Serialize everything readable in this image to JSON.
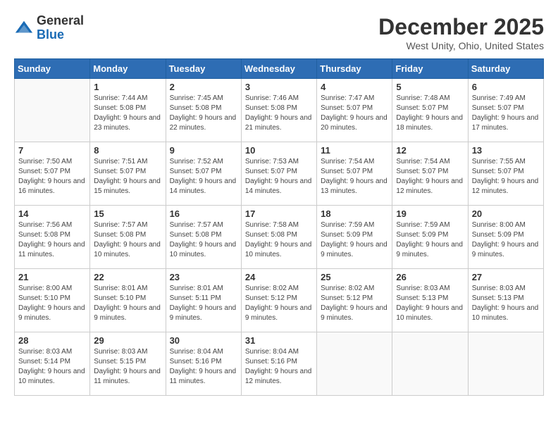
{
  "logo": {
    "general": "General",
    "blue": "Blue"
  },
  "title": "December 2025",
  "location": "West Unity, Ohio, United States",
  "days_header": [
    "Sunday",
    "Monday",
    "Tuesday",
    "Wednesday",
    "Thursday",
    "Friday",
    "Saturday"
  ],
  "weeks": [
    [
      {
        "day": "",
        "sunrise": "",
        "sunset": "",
        "daylight": ""
      },
      {
        "day": "1",
        "sunrise": "Sunrise: 7:44 AM",
        "sunset": "Sunset: 5:08 PM",
        "daylight": "Daylight: 9 hours and 23 minutes."
      },
      {
        "day": "2",
        "sunrise": "Sunrise: 7:45 AM",
        "sunset": "Sunset: 5:08 PM",
        "daylight": "Daylight: 9 hours and 22 minutes."
      },
      {
        "day": "3",
        "sunrise": "Sunrise: 7:46 AM",
        "sunset": "Sunset: 5:08 PM",
        "daylight": "Daylight: 9 hours and 21 minutes."
      },
      {
        "day": "4",
        "sunrise": "Sunrise: 7:47 AM",
        "sunset": "Sunset: 5:07 PM",
        "daylight": "Daylight: 9 hours and 20 minutes."
      },
      {
        "day": "5",
        "sunrise": "Sunrise: 7:48 AM",
        "sunset": "Sunset: 5:07 PM",
        "daylight": "Daylight: 9 hours and 18 minutes."
      },
      {
        "day": "6",
        "sunrise": "Sunrise: 7:49 AM",
        "sunset": "Sunset: 5:07 PM",
        "daylight": "Daylight: 9 hours and 17 minutes."
      }
    ],
    [
      {
        "day": "7",
        "sunrise": "Sunrise: 7:50 AM",
        "sunset": "Sunset: 5:07 PM",
        "daylight": "Daylight: 9 hours and 16 minutes."
      },
      {
        "day": "8",
        "sunrise": "Sunrise: 7:51 AM",
        "sunset": "Sunset: 5:07 PM",
        "daylight": "Daylight: 9 hours and 15 minutes."
      },
      {
        "day": "9",
        "sunrise": "Sunrise: 7:52 AM",
        "sunset": "Sunset: 5:07 PM",
        "daylight": "Daylight: 9 hours and 14 minutes."
      },
      {
        "day": "10",
        "sunrise": "Sunrise: 7:53 AM",
        "sunset": "Sunset: 5:07 PM",
        "daylight": "Daylight: 9 hours and 14 minutes."
      },
      {
        "day": "11",
        "sunrise": "Sunrise: 7:54 AM",
        "sunset": "Sunset: 5:07 PM",
        "daylight": "Daylight: 9 hours and 13 minutes."
      },
      {
        "day": "12",
        "sunrise": "Sunrise: 7:54 AM",
        "sunset": "Sunset: 5:07 PM",
        "daylight": "Daylight: 9 hours and 12 minutes."
      },
      {
        "day": "13",
        "sunrise": "Sunrise: 7:55 AM",
        "sunset": "Sunset: 5:07 PM",
        "daylight": "Daylight: 9 hours and 12 minutes."
      }
    ],
    [
      {
        "day": "14",
        "sunrise": "Sunrise: 7:56 AM",
        "sunset": "Sunset: 5:08 PM",
        "daylight": "Daylight: 9 hours and 11 minutes."
      },
      {
        "day": "15",
        "sunrise": "Sunrise: 7:57 AM",
        "sunset": "Sunset: 5:08 PM",
        "daylight": "Daylight: 9 hours and 10 minutes."
      },
      {
        "day": "16",
        "sunrise": "Sunrise: 7:57 AM",
        "sunset": "Sunset: 5:08 PM",
        "daylight": "Daylight: 9 hours and 10 minutes."
      },
      {
        "day": "17",
        "sunrise": "Sunrise: 7:58 AM",
        "sunset": "Sunset: 5:08 PM",
        "daylight": "Daylight: 9 hours and 10 minutes."
      },
      {
        "day": "18",
        "sunrise": "Sunrise: 7:59 AM",
        "sunset": "Sunset: 5:09 PM",
        "daylight": "Daylight: 9 hours and 9 minutes."
      },
      {
        "day": "19",
        "sunrise": "Sunrise: 7:59 AM",
        "sunset": "Sunset: 5:09 PM",
        "daylight": "Daylight: 9 hours and 9 minutes."
      },
      {
        "day": "20",
        "sunrise": "Sunrise: 8:00 AM",
        "sunset": "Sunset: 5:09 PM",
        "daylight": "Daylight: 9 hours and 9 minutes."
      }
    ],
    [
      {
        "day": "21",
        "sunrise": "Sunrise: 8:00 AM",
        "sunset": "Sunset: 5:10 PM",
        "daylight": "Daylight: 9 hours and 9 minutes."
      },
      {
        "day": "22",
        "sunrise": "Sunrise: 8:01 AM",
        "sunset": "Sunset: 5:10 PM",
        "daylight": "Daylight: 9 hours and 9 minutes."
      },
      {
        "day": "23",
        "sunrise": "Sunrise: 8:01 AM",
        "sunset": "Sunset: 5:11 PM",
        "daylight": "Daylight: 9 hours and 9 minutes."
      },
      {
        "day": "24",
        "sunrise": "Sunrise: 8:02 AM",
        "sunset": "Sunset: 5:12 PM",
        "daylight": "Daylight: 9 hours and 9 minutes."
      },
      {
        "day": "25",
        "sunrise": "Sunrise: 8:02 AM",
        "sunset": "Sunset: 5:12 PM",
        "daylight": "Daylight: 9 hours and 9 minutes."
      },
      {
        "day": "26",
        "sunrise": "Sunrise: 8:03 AM",
        "sunset": "Sunset: 5:13 PM",
        "daylight": "Daylight: 9 hours and 10 minutes."
      },
      {
        "day": "27",
        "sunrise": "Sunrise: 8:03 AM",
        "sunset": "Sunset: 5:13 PM",
        "daylight": "Daylight: 9 hours and 10 minutes."
      }
    ],
    [
      {
        "day": "28",
        "sunrise": "Sunrise: 8:03 AM",
        "sunset": "Sunset: 5:14 PM",
        "daylight": "Daylight: 9 hours and 10 minutes."
      },
      {
        "day": "29",
        "sunrise": "Sunrise: 8:03 AM",
        "sunset": "Sunset: 5:15 PM",
        "daylight": "Daylight: 9 hours and 11 minutes."
      },
      {
        "day": "30",
        "sunrise": "Sunrise: 8:04 AM",
        "sunset": "Sunset: 5:16 PM",
        "daylight": "Daylight: 9 hours and 11 minutes."
      },
      {
        "day": "31",
        "sunrise": "Sunrise: 8:04 AM",
        "sunset": "Sunset: 5:16 PM",
        "daylight": "Daylight: 9 hours and 12 minutes."
      },
      {
        "day": "",
        "sunrise": "",
        "sunset": "",
        "daylight": ""
      },
      {
        "day": "",
        "sunrise": "",
        "sunset": "",
        "daylight": ""
      },
      {
        "day": "",
        "sunrise": "",
        "sunset": "",
        "daylight": ""
      }
    ]
  ]
}
